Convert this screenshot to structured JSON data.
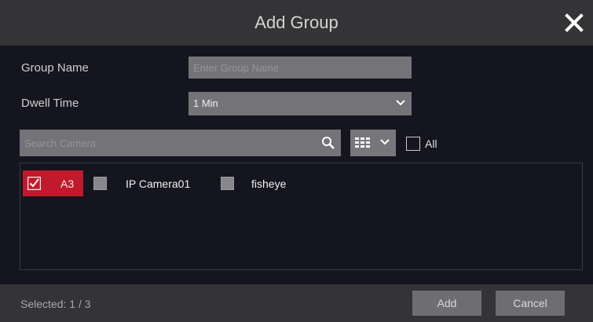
{
  "dialog": {
    "title": "Add Group",
    "close_icon": "close-icon"
  },
  "form": {
    "group_name_label": "Group Name",
    "group_name_value": "",
    "group_name_placeholder": "Enter Group Name",
    "dwell_time_label": "Dwell Time",
    "dwell_time_value": "1 Min"
  },
  "search": {
    "placeholder": "Search Camera",
    "value": "",
    "icon": "search-icon"
  },
  "view_mode": {
    "icon": "grid-view-icon"
  },
  "select_all": {
    "label": "All",
    "checked": false
  },
  "cameras": [
    {
      "name": "A3",
      "checked": true
    },
    {
      "name": "IP Camera01",
      "checked": false
    },
    {
      "name": "fisheye",
      "checked": false
    }
  ],
  "footer": {
    "selected_text": "Selected: 1 / 3",
    "add_label": "Add",
    "cancel_label": "Cancel"
  },
  "colors": {
    "accent": "#c2192c",
    "titlebar": "#343436",
    "background": "#15151f"
  }
}
